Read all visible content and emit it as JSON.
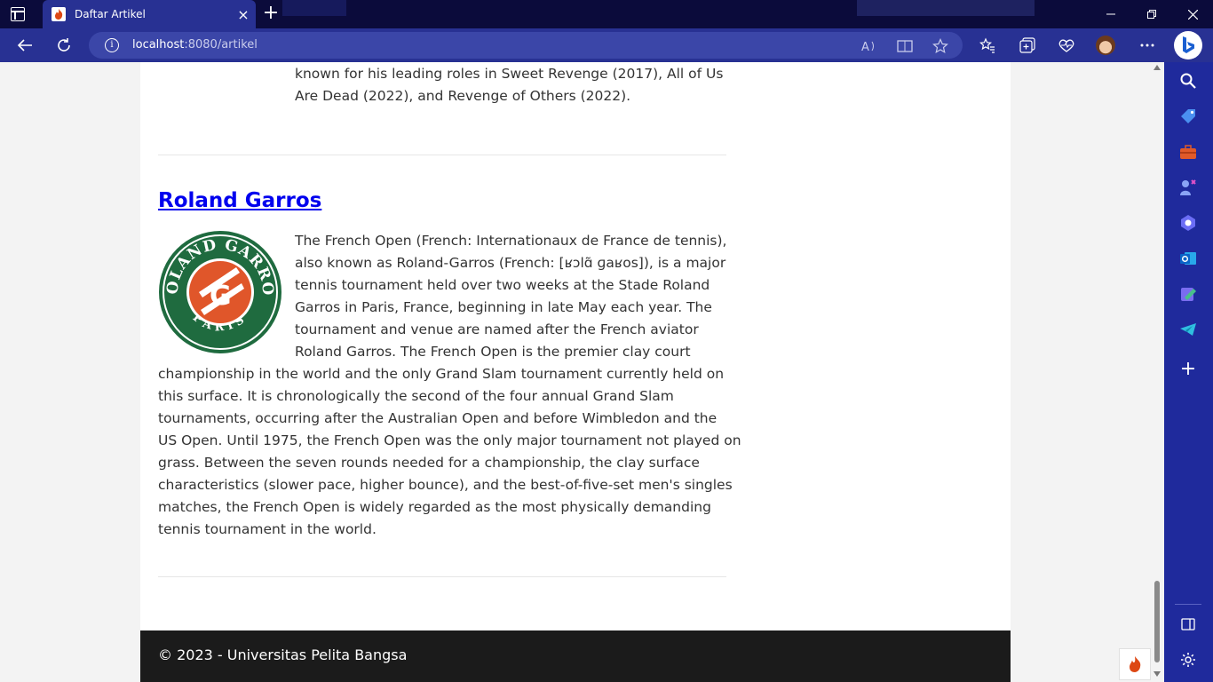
{
  "browser": {
    "tab_title": "Daftar Artikel",
    "tab_close": "×",
    "new_tab": "+",
    "url_host": "localhost",
    "url_path": ":8080/artikel",
    "info_glyph": "i",
    "icons": [
      "back-icon",
      "refresh-icon",
      "read-aloud-icon",
      "immersive-reader-icon",
      "favorite-star-icon",
      "favorites-icon",
      "collections-icon",
      "performance-icon",
      "profile-avatar",
      "more-icon",
      "bing-copilot-icon"
    ],
    "window_controls": [
      "minimize-icon",
      "restore-icon",
      "close-icon"
    ],
    "accent": "#283193",
    "titlebar_color": "#0b0b3b"
  },
  "page": {
    "previous_article_tail": [
      "known for his leading roles in Sweet Revenge (2017), All of Us",
      "Are Dead (2022), and Revenge of Others (2022)."
    ],
    "article": {
      "title": "Roland Garros",
      "logo_ring_top": "ROLAND GARROS",
      "logo_ring_bottom": "PARIS",
      "body_lines": [
        "The French Open (French: Internationaux de France de tennis),",
        "also known as Roland-Garros (French: [ʁɔlɑ̃ ɡaʁos]), is a major",
        "tennis tournament held over two weeks at the Stade Roland",
        "Garros in Paris, France, beginning in late May each year. The",
        "tournament and venue are named after the French aviator",
        "Roland Garros. The French Open is the premier clay court",
        "championship in the world and the only Grand Slam tournament currently held on",
        "this surface. It is chronologically the second of the four annual Grand Slam",
        "tournaments, occurring after the Australian Open and before Wimbledon and the",
        "US Open. Until 1975, the French Open was the only major tournament not played on",
        "grass. Between the seven rounds needed for a championship, the clay surface",
        "characteristics (slower pace, higher bounce), and the best-of-five-set men's singles",
        "matches, the French Open is widely regarded as the most physically demanding",
        "tennis tournament in the world."
      ]
    },
    "footer": "© 2023 - Universitas Pelita Bangsa"
  },
  "sidebar": {
    "icons": [
      "search-icon",
      "shopping-tag-icon",
      "tools-icon",
      "games-icon",
      "copilot-icon",
      "outlook-icon",
      "drop-icon",
      "telegram-icon",
      "add-icon",
      "split-screen-icon",
      "settings-icon"
    ],
    "add_glyph": "+"
  }
}
